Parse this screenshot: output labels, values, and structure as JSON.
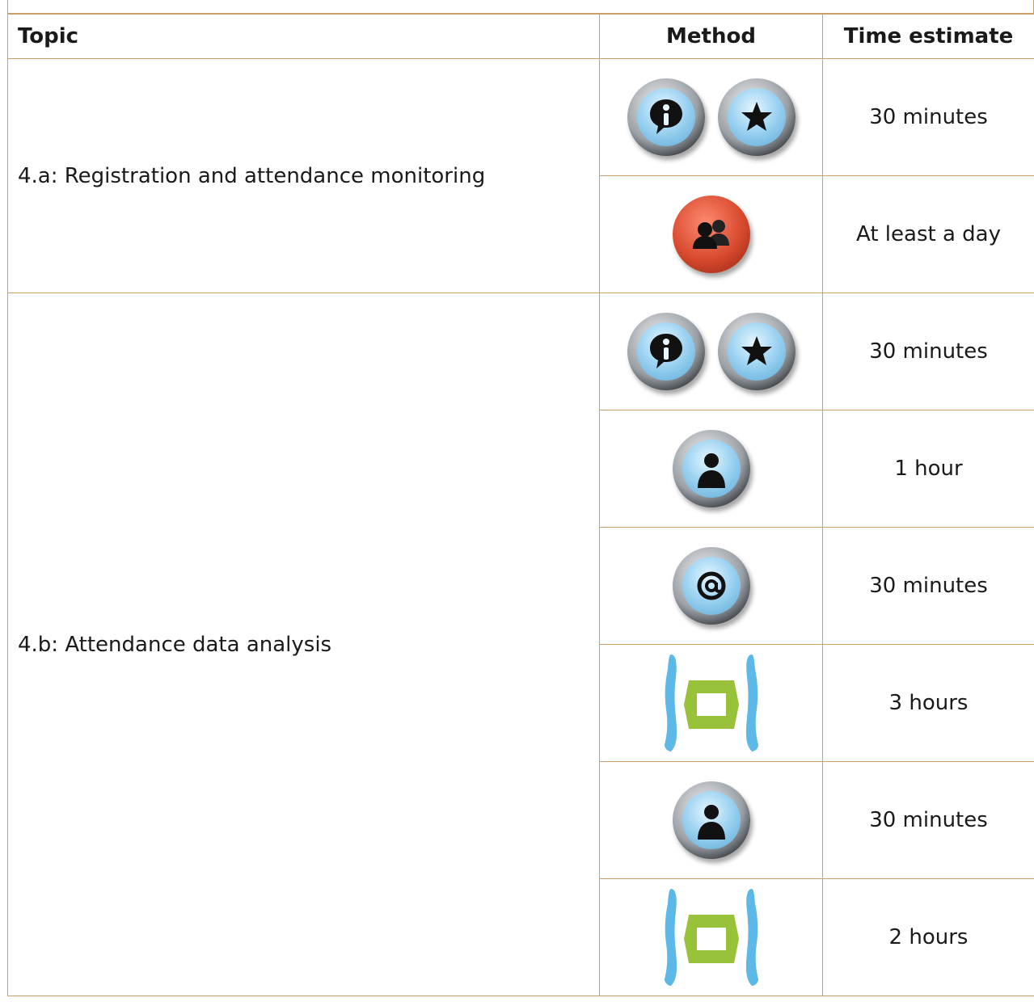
{
  "table": {
    "headers": {
      "topic": "Topic",
      "method": "Method",
      "time": "Time estimate"
    },
    "groups": [
      {
        "topic": "4.a: Registration and attendance monitoring",
        "rows": [
          {
            "icons": [
              "info-icon",
              "star-icon"
            ],
            "time": "30 minutes"
          },
          {
            "icons": [
              "group-icon"
            ],
            "time": "At least a day"
          }
        ]
      },
      {
        "topic": "4.b: Attendance data analysis",
        "rows": [
          {
            "icons": [
              "info-icon",
              "star-icon"
            ],
            "time": "30 minutes"
          },
          {
            "icons": [
              "person-icon"
            ],
            "time": "1 hour"
          },
          {
            "icons": [
              "email-icon"
            ],
            "time": "30 minutes"
          },
          {
            "icons": [
              "bridge-icon"
            ],
            "time": "3 hours"
          },
          {
            "icons": [
              "person-icon"
            ],
            "time": "30 minutes"
          },
          {
            "icons": [
              "bridge-icon"
            ],
            "time": "2 hours"
          }
        ]
      }
    ]
  },
  "colors": {
    "border": "#c9a06a",
    "bridge_blue": "#5cb8e6",
    "bridge_green": "#98c23a",
    "orb_red": "#d84a2e"
  }
}
